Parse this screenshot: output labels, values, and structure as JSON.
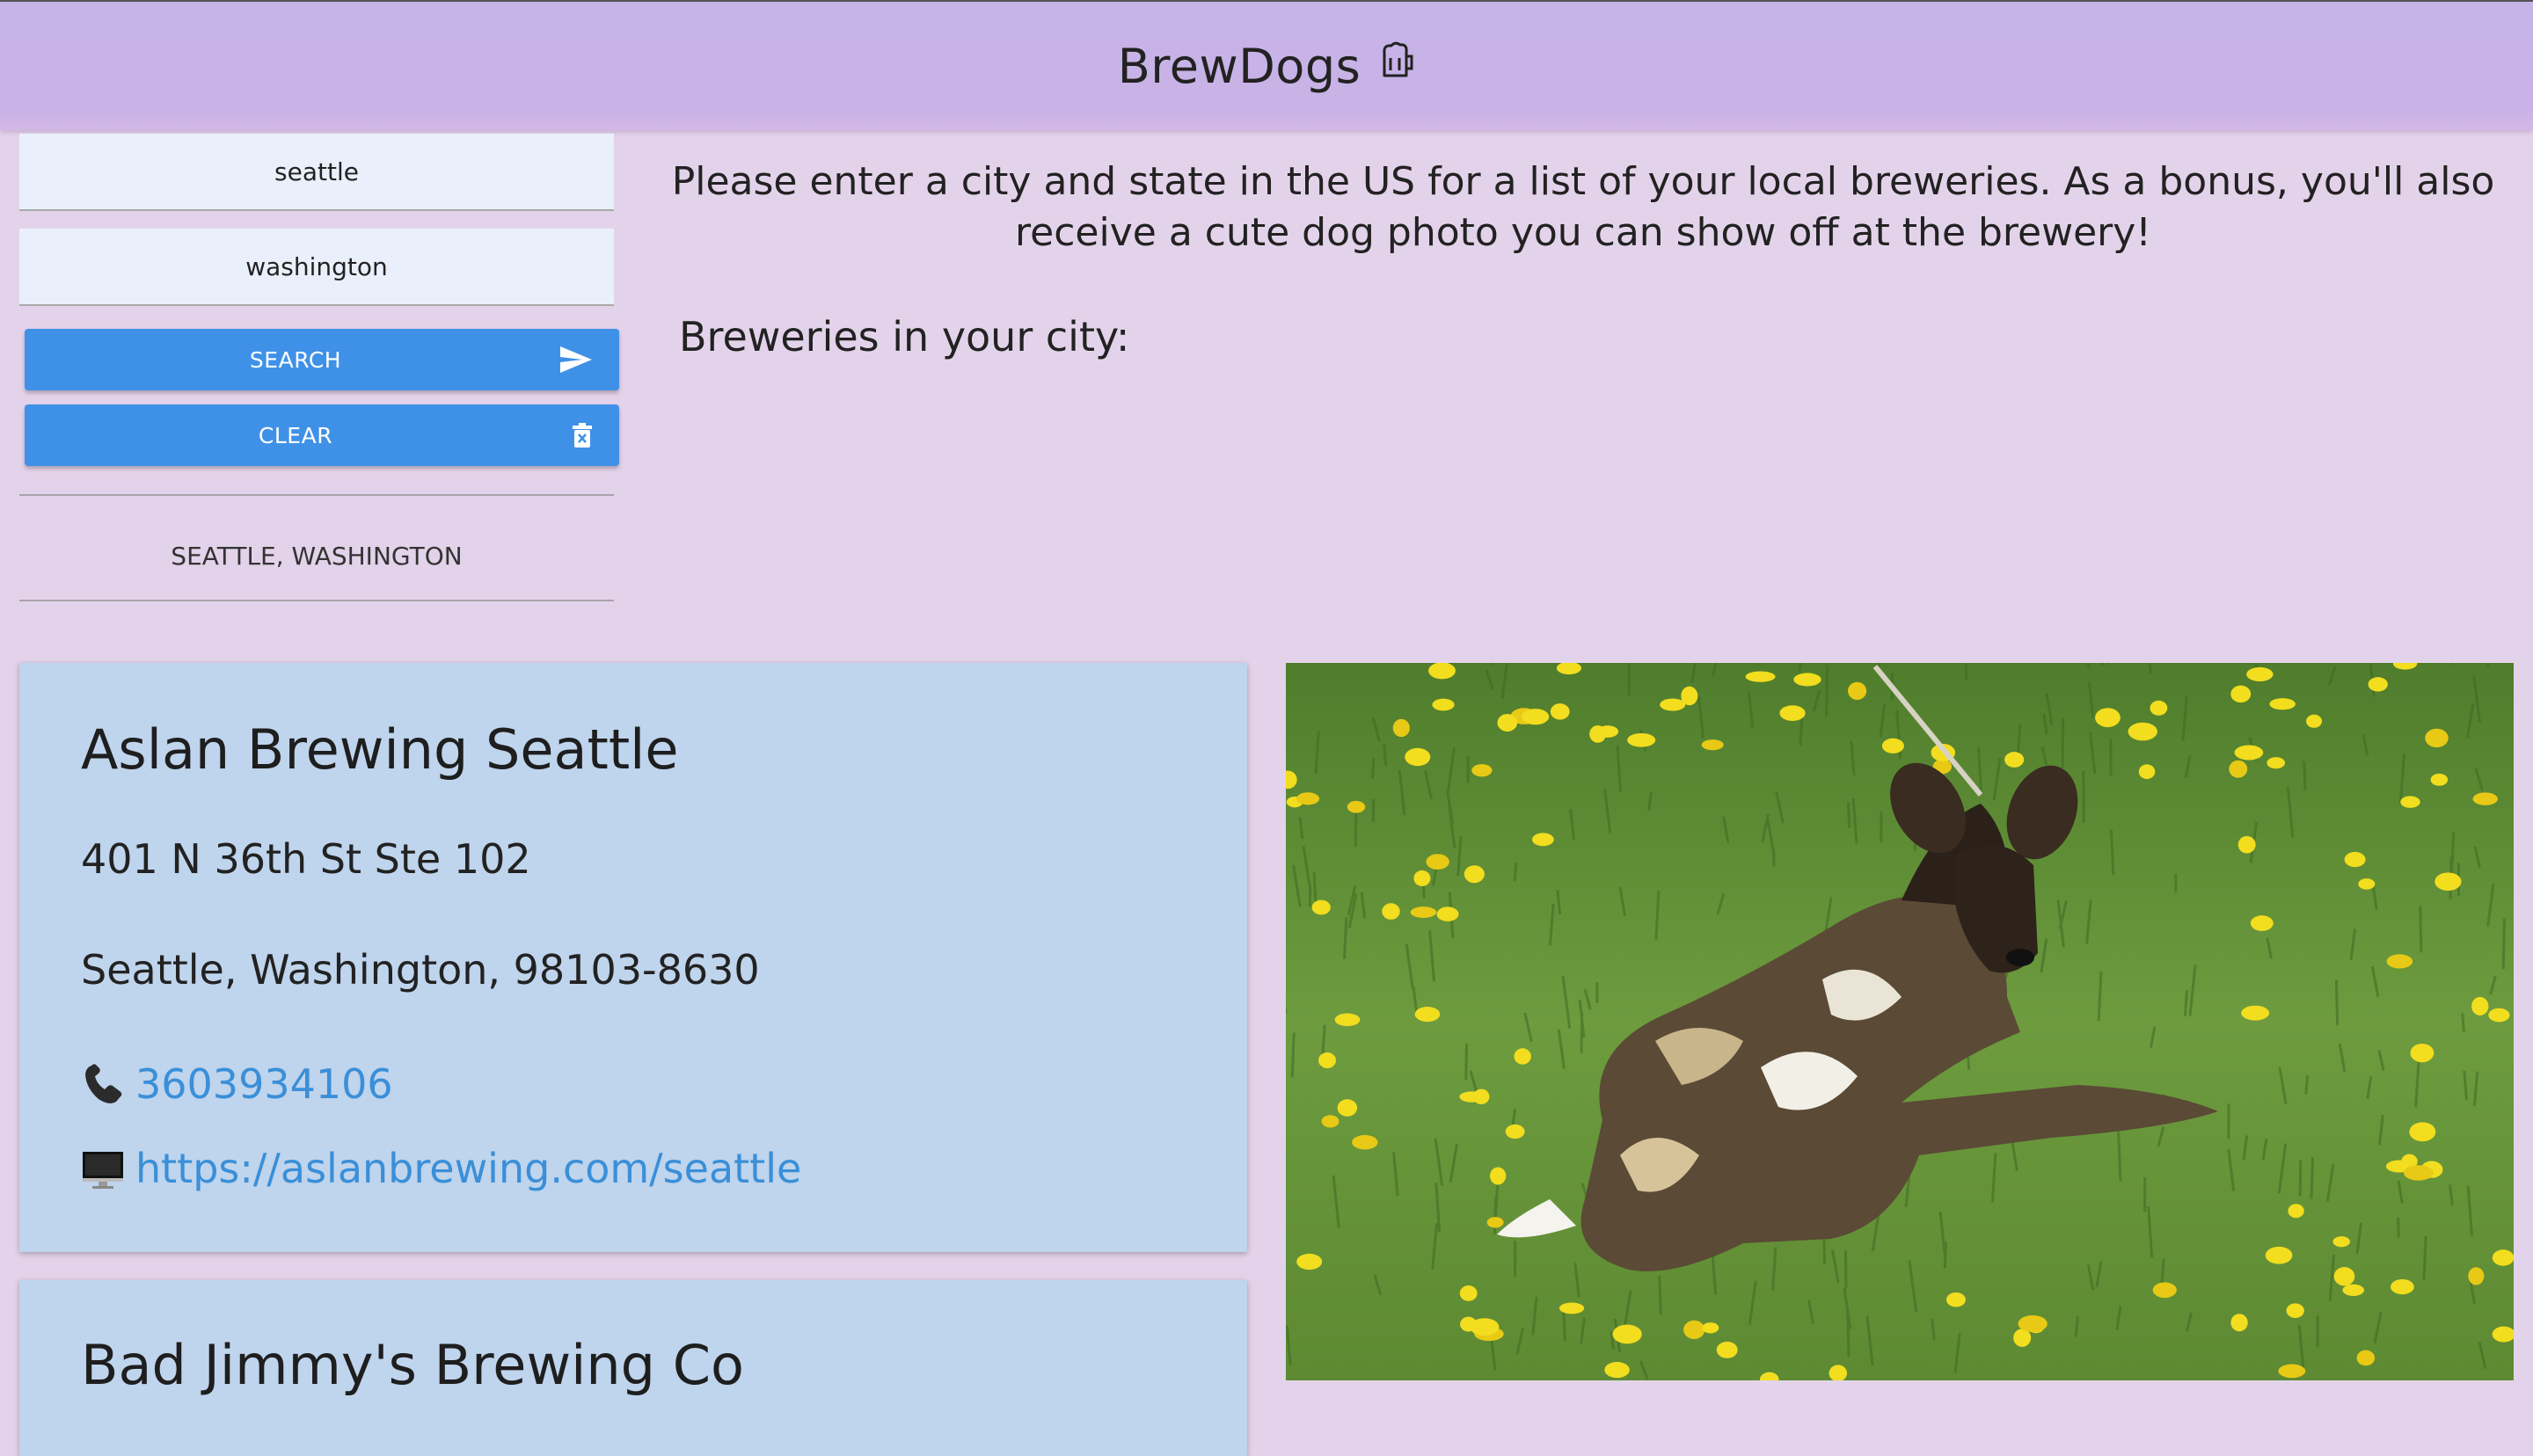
{
  "header": {
    "title": "BrewDogs",
    "icon": "beer-mug-icon"
  },
  "search": {
    "city_value": "seattle",
    "state_value": "washington",
    "search_label": "SEARCH",
    "search_icon": "send-icon",
    "clear_label": "CLEAR",
    "clear_icon": "trash-icon"
  },
  "location_label": "SEATTLE, WASHINGTON",
  "intro": "Please enter a city and state in the US for a list of your local breweries. As a bonus, you'll also receive a cute dog photo you can show off at the brewery!",
  "breweries_heading": "Breweries in your city:",
  "breweries": [
    {
      "name": "Aslan Brewing Seattle",
      "street": "401 N 36th St Ste 102",
      "city_state_zip": "Seattle, Washington, 98103-8630",
      "phone": "3603934106",
      "website": "https://aslanbrewing.com/seattle",
      "phone_icon": "phone-icon",
      "website_icon": "computer-icon"
    },
    {
      "name": "Bad Jimmy's Brewing Co"
    }
  ],
  "dog_photo": {
    "subject": "african-wild-dog-in-dandelion-field"
  },
  "colors": {
    "header": "#c6b4e8",
    "background": "#e3d3ea",
    "button": "#3f91e8",
    "card": "#bfd4ed",
    "link": "#3a8fd8"
  }
}
